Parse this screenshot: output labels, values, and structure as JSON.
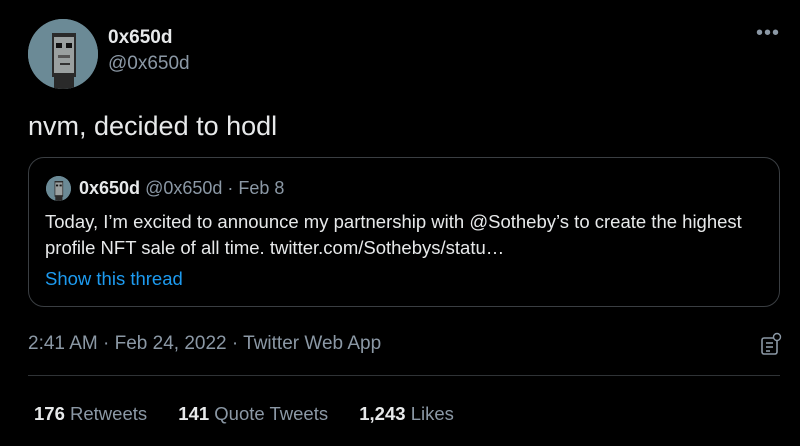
{
  "author": {
    "display_name": "0x650d",
    "handle": "@0x650d",
    "avatar_icon": "pixel-punk-avatar"
  },
  "tweet": {
    "text": "nvm, decided to hodl",
    "more_icon": "more-horizontal-icon"
  },
  "quoted_tweet": {
    "display_name": "0x650d",
    "meta": "@0x650d · Feb 8",
    "text": "Today, I’m excited to announce my partnership with @Sotheby’s to create the highest profile NFT sale of all time. twitter.com/Sothebys/statu…",
    "show_thread": "Show this thread"
  },
  "metadata": {
    "time": "2:41 AM",
    "date": "Feb 24, 2022",
    "source": "Twitter Web App",
    "separator": " · "
  },
  "stats": [
    {
      "count": "176",
      "label": "Retweets"
    },
    {
      "count": "141",
      "label": "Quote Tweets"
    },
    {
      "count": "1,243",
      "label": "Likes"
    }
  ],
  "colors": {
    "background": "#000000",
    "primary_text": "#e7e9ea",
    "secondary_text": "#8b98a5",
    "link": "#1d9bf0",
    "border": "#3a3e42"
  }
}
